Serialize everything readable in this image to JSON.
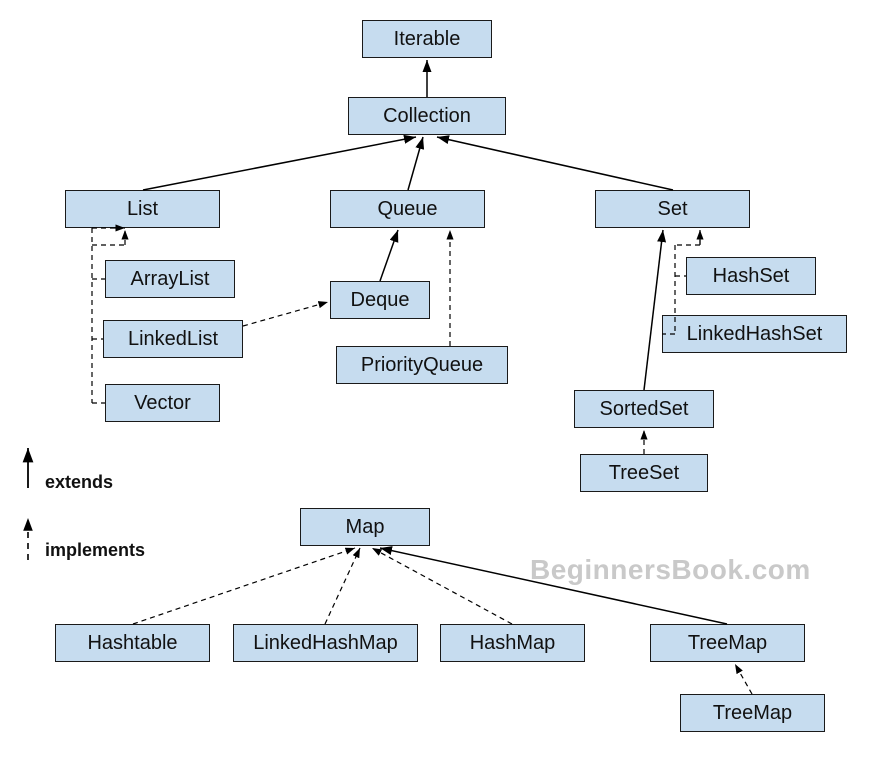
{
  "nodes": {
    "iterable": "Iterable",
    "collection": "Collection",
    "list": "List",
    "queue": "Queue",
    "set": "Set",
    "arraylist": "ArrayList",
    "linkedlist": "LinkedList",
    "vector": "Vector",
    "deque": "Deque",
    "priorityqueue": "PriorityQueue",
    "hashset": "HashSet",
    "linkedhashset": "LinkedHashSet",
    "sortedset": "SortedSet",
    "treeset": "TreeSet",
    "map": "Map",
    "hashtable": "Hashtable",
    "linkedhashmap": "LinkedHashMap",
    "hashmap": "HashMap",
    "treemap": "TreeMap",
    "treemap2": "TreeMap"
  },
  "legend": {
    "extends": "extends",
    "implements": "implements"
  },
  "watermark": "BeginnersBook.com",
  "colors": {
    "node_fill": "#c6dcef",
    "node_border": "#1a1a1a",
    "connector": "#000000",
    "watermark": "#c9c9c9"
  },
  "relationships": {
    "extends": [
      [
        "Collection",
        "Iterable"
      ],
      [
        "List",
        "Collection"
      ],
      [
        "Queue",
        "Collection"
      ],
      [
        "Set",
        "Collection"
      ],
      [
        "Deque",
        "Queue"
      ],
      [
        "SortedSet",
        "Set"
      ],
      [
        "TreeMap",
        "Map"
      ]
    ],
    "implements": [
      [
        "ArrayList",
        "List"
      ],
      [
        "LinkedList",
        "List"
      ],
      [
        "Vector",
        "List"
      ],
      [
        "LinkedList",
        "Deque"
      ],
      [
        "PriorityQueue",
        "Queue"
      ],
      [
        "HashSet",
        "Set"
      ],
      [
        "LinkedHashSet",
        "Set"
      ],
      [
        "TreeSet",
        "SortedSet"
      ],
      [
        "Hashtable",
        "Map"
      ],
      [
        "LinkedHashMap",
        "Map"
      ],
      [
        "HashMap",
        "Map"
      ],
      [
        "TreeMap",
        "TreeMap"
      ]
    ]
  }
}
